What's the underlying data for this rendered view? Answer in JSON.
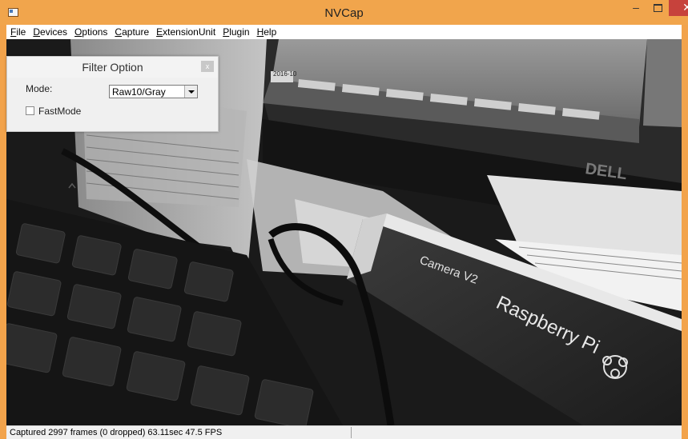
{
  "window": {
    "title": "NVCap",
    "minimize_glyph": "–",
    "close_glyph": "✕"
  },
  "menu": [
    {
      "label_first": "F",
      "label_rest": "ile"
    },
    {
      "label_first": "D",
      "label_rest": "evices"
    },
    {
      "label_first": "O",
      "label_rest": "ptions"
    },
    {
      "label_first": "C",
      "label_rest": "apture"
    },
    {
      "label_first": "E",
      "label_rest": "xtensionUnit"
    },
    {
      "label_first": "P",
      "label_rest": "lugin"
    },
    {
      "label_first": "H",
      "label_rest": "elp"
    }
  ],
  "filter_dialog": {
    "title": "Filter Option",
    "close_glyph": "x",
    "mode_label": "Mode:",
    "mode_value": "Raw10/Gray",
    "fastmode_label": "FastMode",
    "fastmode_checked": false
  },
  "preview": {
    "box_text_1": "Camera V2",
    "box_text_2": "Raspberry Pi",
    "monitor_brand": "DELL",
    "tab_label": "2016-10"
  },
  "status": {
    "text": "Captured 2997 frames (0 dropped) 63.11sec 47.5 FPS"
  },
  "colors": {
    "titlebar": "#f1a54c",
    "close_button": "#c7423c"
  }
}
